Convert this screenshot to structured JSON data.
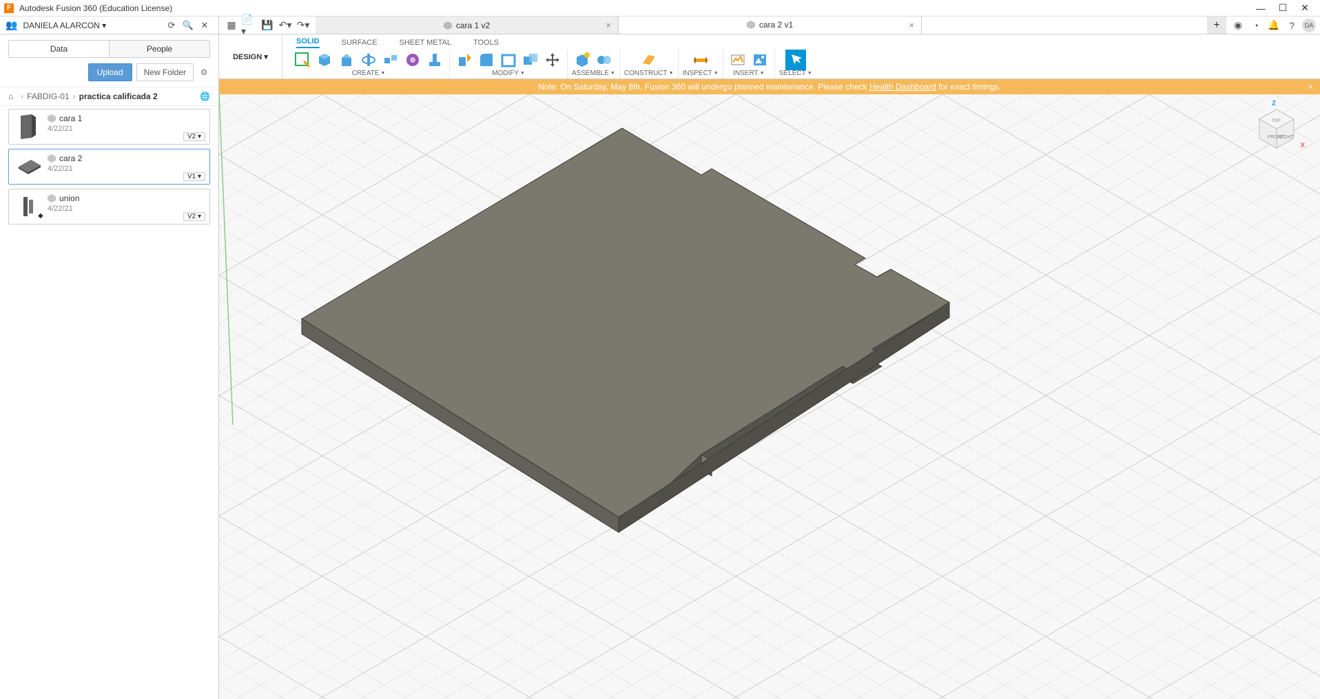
{
  "app": {
    "title": "Autodesk Fusion 360 (Education License)",
    "user": "DANIELA ALARCON",
    "avatar_initials": "DA"
  },
  "window_buttons": {
    "min": "—",
    "max": "☐",
    "close": "✕"
  },
  "qat": {
    "undo": "↶",
    "redo": "↷"
  },
  "doc_tabs": [
    {
      "name": "cara 1 v2",
      "active": false
    },
    {
      "name": "cara 2 v1",
      "active": true
    }
  ],
  "data_panel": {
    "tabs": {
      "data": "Data",
      "people": "People"
    },
    "upload": "Upload",
    "new_folder": "New Folder",
    "breadcrumb": {
      "proj": "FABDIG-01",
      "folder": "practica calificada 2"
    },
    "files": [
      {
        "name": "cara 1",
        "date": "4/22/21",
        "version": "V2 ▾",
        "thumb": "panel-vert"
      },
      {
        "name": "cara 2",
        "date": "4/22/21",
        "version": "V1 ▾",
        "thumb": "panel-flat",
        "active": true
      },
      {
        "name": "union",
        "date": "4/22/21",
        "version": "V2 ▾",
        "thumb": "assembly",
        "branch": "◆"
      }
    ]
  },
  "workspace_button": "DESIGN ▾",
  "ribbon_tabs": [
    "SOLID",
    "SURFACE",
    "SHEET METAL",
    "TOOLS"
  ],
  "ribbon_active_tab": "SOLID",
  "ribbon_groups": [
    {
      "label": "CREATE",
      "dd": true,
      "icons": [
        "sketch",
        "box",
        "cyl",
        "sphere",
        "torus",
        "coil",
        "pipe"
      ]
    },
    {
      "label": "MODIFY",
      "dd": true,
      "icons": [
        "presspull",
        "fillet",
        "shell",
        "combine",
        "move"
      ]
    },
    {
      "label": "ASSEMBLE",
      "dd": true,
      "icons": [
        "newcomp",
        "joint"
      ]
    },
    {
      "label": "CONSTRUCT",
      "dd": true,
      "icons": [
        "plane"
      ]
    },
    {
      "label": "INSPECT",
      "dd": true,
      "icons": [
        "measure"
      ]
    },
    {
      "label": "INSERT",
      "dd": true,
      "icons": [
        "decal",
        "canvas"
      ]
    },
    {
      "label": "SELECT",
      "dd": true,
      "icons": [
        "select"
      ]
    }
  ],
  "notification": {
    "prefix": "Note: On Saturday, May 8th, Fusion 360 will undergo planned maintenance. Please check ",
    "link": "Health Dashboard",
    "suffix": " for exact timings."
  },
  "viewcube": {
    "z": "Z",
    "x": "X",
    "front": "FRONT",
    "right": "RIGHT",
    "top": "TOP"
  }
}
